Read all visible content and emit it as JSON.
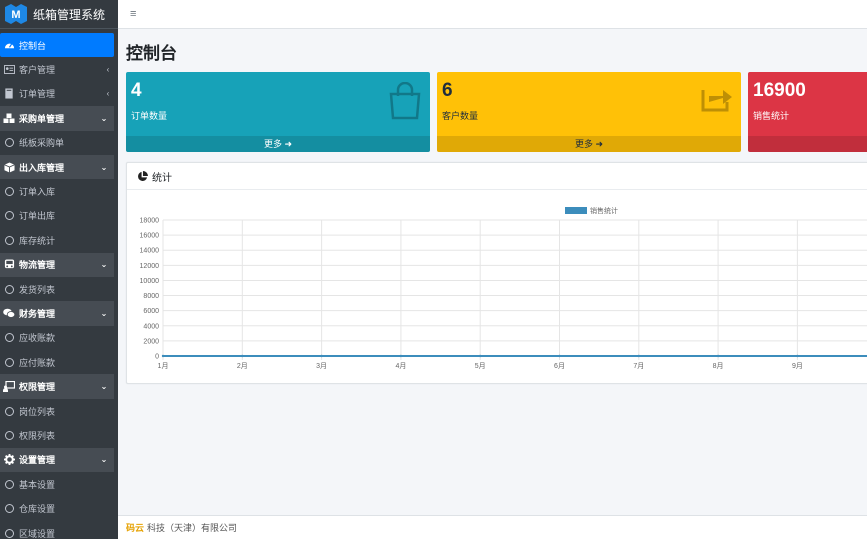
{
  "app": {
    "title": "纸箱管理系统"
  },
  "sidebar": {
    "items": [
      {
        "label": "控制台",
        "icon": "dashboard-icon",
        "kind": "active",
        "chev": ""
      },
      {
        "label": "客户管理",
        "icon": "id-card-icon",
        "kind": "plain",
        "chev": "‹"
      },
      {
        "label": "订单管理",
        "icon": "book-icon",
        "kind": "plain",
        "chev": "‹"
      },
      {
        "label": "采购单管理",
        "icon": "cubes-icon",
        "kind": "header",
        "chev": "⌄"
      },
      {
        "label": "纸板采购单",
        "icon": "circle-icon",
        "kind": "sub",
        "chev": ""
      },
      {
        "label": "出入库管理",
        "icon": "box-icon",
        "kind": "header",
        "chev": "⌄"
      },
      {
        "label": "订单入库",
        "icon": "circle-icon",
        "kind": "sub",
        "chev": ""
      },
      {
        "label": "订单出库",
        "icon": "circle-icon",
        "kind": "sub",
        "chev": ""
      },
      {
        "label": "库存统计",
        "icon": "circle-icon",
        "kind": "sub",
        "chev": ""
      },
      {
        "label": "物流管理",
        "icon": "bus-icon",
        "kind": "header",
        "chev": "⌄"
      },
      {
        "label": "发货列表",
        "icon": "circle-icon",
        "kind": "sub",
        "chev": ""
      },
      {
        "label": "财务管理",
        "icon": "comments-icon",
        "kind": "header",
        "chev": "⌄"
      },
      {
        "label": "应收账款",
        "icon": "circle-icon",
        "kind": "sub",
        "chev": ""
      },
      {
        "label": "应付账款",
        "icon": "circle-icon",
        "kind": "sub",
        "chev": ""
      },
      {
        "label": "权限管理",
        "icon": "chalkboard-user-icon",
        "kind": "header",
        "chev": "⌄"
      },
      {
        "label": "岗位列表",
        "icon": "circle-icon",
        "kind": "sub",
        "chev": ""
      },
      {
        "label": "权限列表",
        "icon": "circle-icon",
        "kind": "sub",
        "chev": ""
      },
      {
        "label": "设置管理",
        "icon": "gear-icon",
        "kind": "header",
        "chev": "⌄"
      },
      {
        "label": "基本设置",
        "icon": "circle-icon",
        "kind": "sub",
        "chev": ""
      },
      {
        "label": "仓库设置",
        "icon": "circle-icon",
        "kind": "sub",
        "chev": ""
      },
      {
        "label": "区域设置",
        "icon": "circle-icon",
        "kind": "sub",
        "chev": ""
      }
    ]
  },
  "topbar": {
    "menu_glyph": "≡"
  },
  "page": {
    "title": "控制台"
  },
  "boxes": [
    {
      "value": "4",
      "label": "订单数量",
      "more": "更多",
      "icon": "shopping-bag-icon",
      "color": "#17a2b8"
    },
    {
      "value": "6",
      "label": "客户数量",
      "more": "更多",
      "icon": "share-square-icon",
      "color": "#ffc107"
    },
    {
      "value": "16900",
      "label": "销售统计",
      "more": "",
      "icon": "",
      "color": "#dc3545"
    }
  ],
  "card": {
    "title": "统计"
  },
  "chart_data": {
    "type": "line",
    "categories": [
      "1月",
      "2月",
      "3月",
      "4月",
      "5月",
      "6月",
      "7月",
      "8月",
      "9月"
    ],
    "series": [
      {
        "name": "销售统计",
        "values": [
          0,
          0,
          0,
          0,
          0,
          0,
          0,
          0,
          0
        ],
        "color": "#3c8dbc"
      }
    ],
    "yticks": [
      0,
      2000,
      4000,
      6000,
      8000,
      10000,
      12000,
      14000,
      16000,
      18000
    ],
    "ylim": [
      0,
      18000
    ],
    "grid": true,
    "legend": "top-center"
  },
  "footer": {
    "brand": "码云",
    "text": "科技（天津）有限公司"
  }
}
